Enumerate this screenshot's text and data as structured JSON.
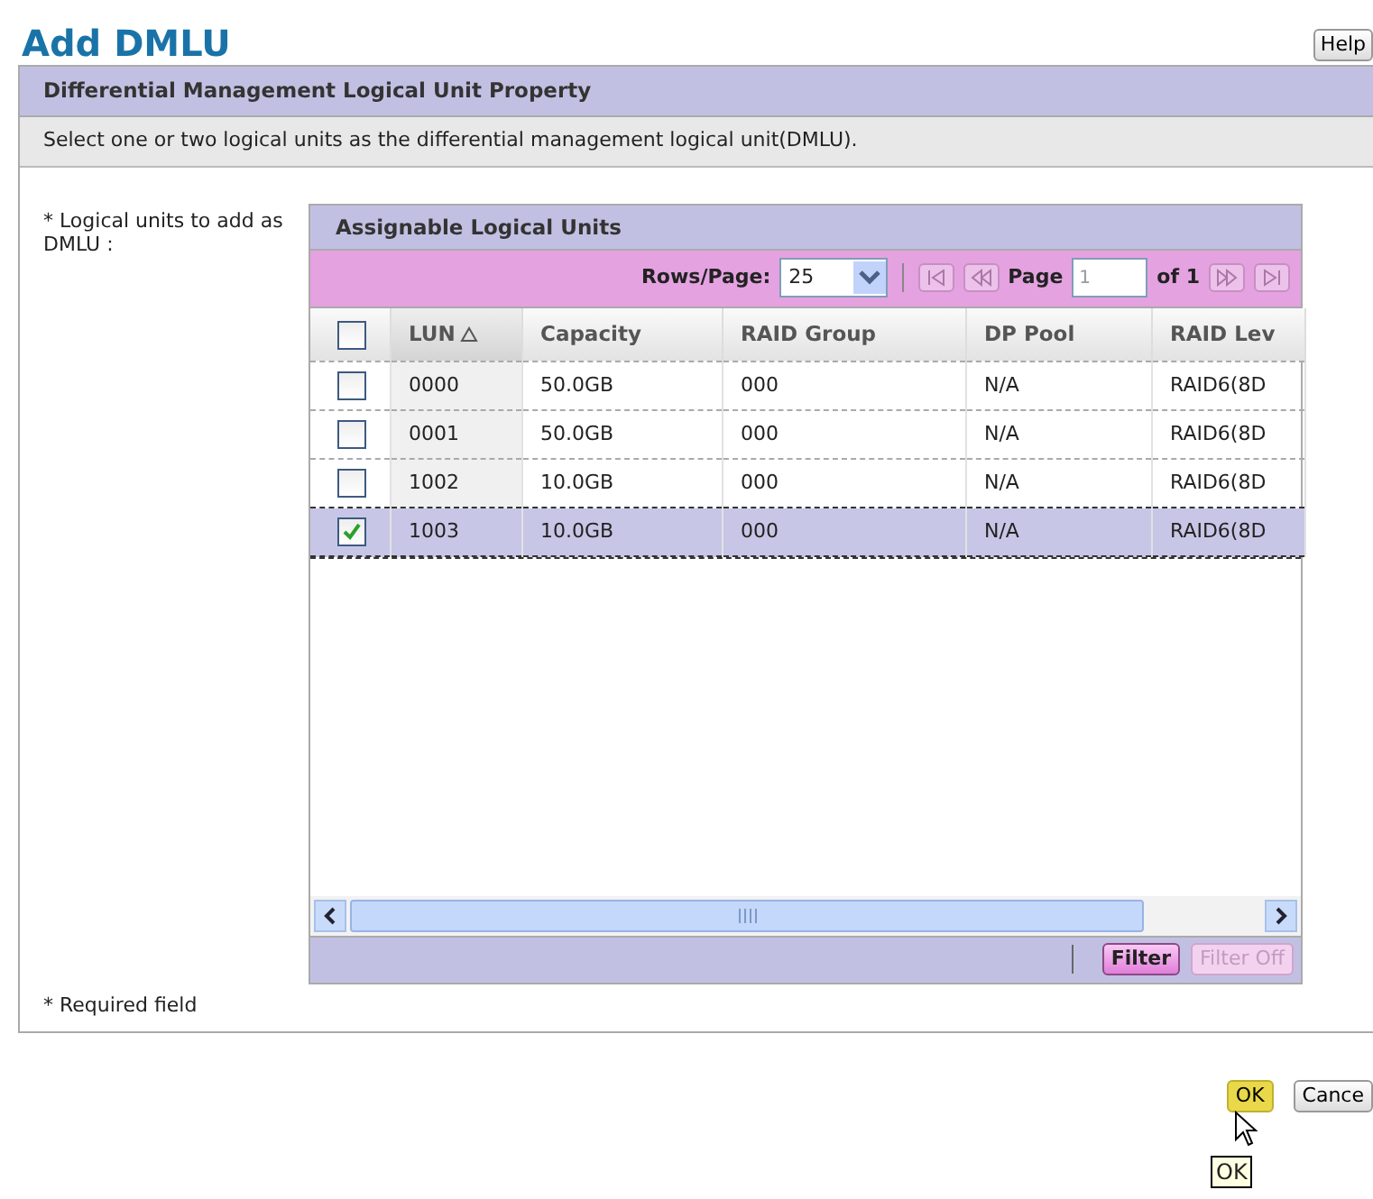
{
  "title": "Add DMLU",
  "help_button": "Help",
  "panel": {
    "title": "Differential Management Logical Unit Property",
    "description": "Select one or two logical units as the differential management logical unit(DMLU)."
  },
  "field_label": "* Logical units to add as DMLU :",
  "table": {
    "title": "Assignable Logical Units",
    "rows_per_page_label": "Rows/Page:",
    "rows_per_page": "25",
    "page_label": "Page",
    "page_value": "1",
    "page_of": "of 1",
    "select_all_checked": false,
    "columns": [
      {
        "label": "LUN",
        "sorted": true
      },
      {
        "label": "Capacity",
        "sorted": false
      },
      {
        "label": "RAID Group",
        "sorted": false
      },
      {
        "label": "DP Pool",
        "sorted": false
      },
      {
        "label": "RAID Lev",
        "sorted": false
      }
    ],
    "rows": [
      {
        "cells": [
          "0000",
          "50.0GB",
          "000",
          "N/A",
          "RAID6(8D"
        ],
        "checked": false,
        "selected": false
      },
      {
        "cells": [
          "0001",
          "50.0GB",
          "000",
          "N/A",
          "RAID6(8D"
        ],
        "checked": false,
        "selected": false
      },
      {
        "cells": [
          "1002",
          "10.0GB",
          "000",
          "N/A",
          "RAID6(8D"
        ],
        "checked": false,
        "selected": false
      },
      {
        "cells": [
          "1003",
          "10.0GB",
          "000",
          "N/A",
          "RAID6(8D"
        ],
        "checked": true,
        "selected": true
      }
    ],
    "filter_button": {
      "label": "Filter",
      "disabled": false
    },
    "filter_off_button": {
      "label": "Filter Off",
      "disabled": true
    }
  },
  "required_note": "* Required field",
  "buttons": [
    {
      "label": "OK",
      "hovered": true
    },
    {
      "label": "Cance",
      "hovered": false
    }
  ],
  "tooltip": "OK"
}
